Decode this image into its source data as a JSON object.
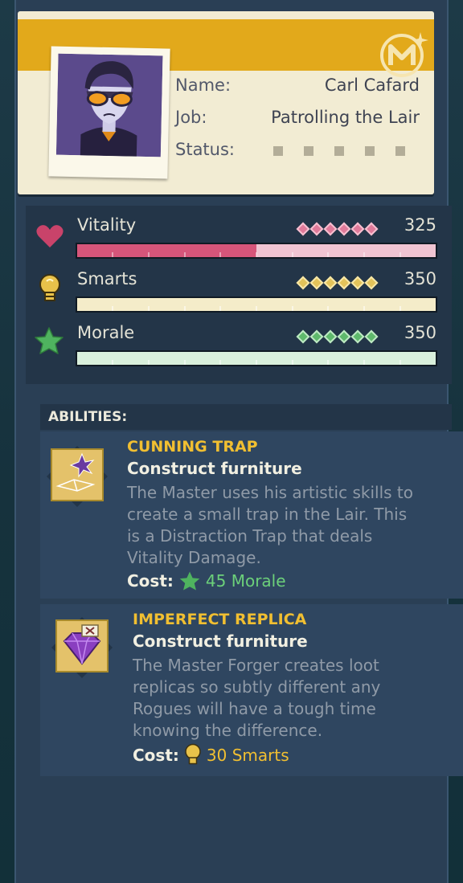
{
  "profile": {
    "name_label": "Name:",
    "name_value": "Carl Cafard",
    "job_label": "Job:",
    "job_value": "Patrolling the Lair",
    "status_label": "Status:"
  },
  "stats": [
    {
      "label": "Vitality",
      "value": "325",
      "fill_fraction": 0.5,
      "icon": "heart-icon"
    },
    {
      "label": "Smarts",
      "value": "350",
      "fill_fraction": 0,
      "icon": "lightbulb-icon"
    },
    {
      "label": "Morale",
      "value": "350",
      "fill_fraction": 0,
      "icon": "star-icon"
    }
  ],
  "abilities_header": "ABILITIES:",
  "abilities": [
    {
      "title": "CUNNING TRAP",
      "subtitle": "Construct furniture",
      "desc_lines": [
        "The Master uses his artistic skills to",
        "create a small trap in the Lair. This",
        "is a Distraction Trap that deals",
        "Vitality Damage."
      ],
      "cost_label": "Cost:",
      "cost_value": "45 Morale",
      "cost_icon": "star-icon",
      "icon": "trap-blueprint-icon"
    },
    {
      "title": "IMPERFECT REPLICA",
      "subtitle": "Construct furniture",
      "desc_lines": [
        "The Master Forger creates loot",
        "replicas so subtly different any",
        "Rogues will have a tough time",
        "knowing the difference."
      ],
      "cost_label": "Cost:",
      "cost_value": "30 Smarts",
      "cost_icon": "lightbulb-icon",
      "icon": "gem-replica-icon"
    }
  ],
  "colors": {
    "vitality": "#d6557a",
    "smarts": "#e8c95a",
    "morale": "#5fc46a",
    "accent": "#f1bf31"
  }
}
